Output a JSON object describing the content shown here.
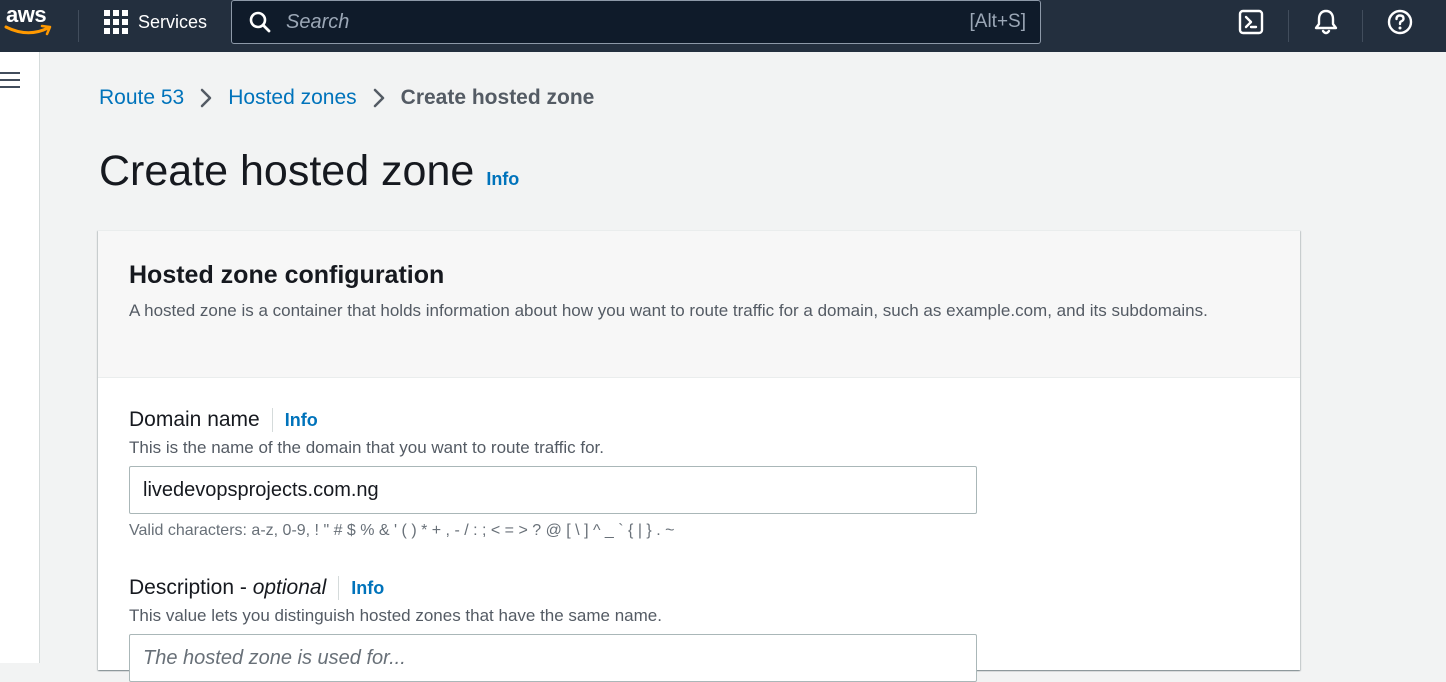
{
  "topnav": {
    "logo_text": "aws",
    "services_label": "Services",
    "search_placeholder": "Search",
    "search_shortcut": "[Alt+S]",
    "icons": [
      "cloudshell-icon",
      "bell-icon",
      "help-icon"
    ]
  },
  "breadcrumb": {
    "items": [
      "Route 53",
      "Hosted zones"
    ],
    "current": "Create hosted zone"
  },
  "page": {
    "title": "Create hosted zone",
    "info_label": "Info"
  },
  "hosted_zone_config": {
    "title": "Hosted zone configuration",
    "description": "A hosted zone is a container that holds information about how you want to route traffic for a domain, such as example.com, and its subdomains.",
    "domain_name": {
      "label": "Domain name",
      "info_label": "Info",
      "description": "This is the name of the domain that you want to route traffic for.",
      "value": "livedevopsprojects.com.ng",
      "constraint": "Valid characters: a-z, 0-9, ! \" # $ % & ' ( ) * + , - / : ; < = > ? @ [ \\ ] ^ _ ` { | } . ~"
    },
    "description_field": {
      "label": "Description - ",
      "label_optional": "optional",
      "info_label": "Info",
      "description": "This value lets you distinguish hosted zones that have the same name.",
      "placeholder": "The hosted zone is used for..."
    }
  },
  "colors": {
    "nav_bg": "#232f3e",
    "link": "#0073bb",
    "page_bg": "#f2f3f3",
    "aws_orange": "#ff9900"
  }
}
